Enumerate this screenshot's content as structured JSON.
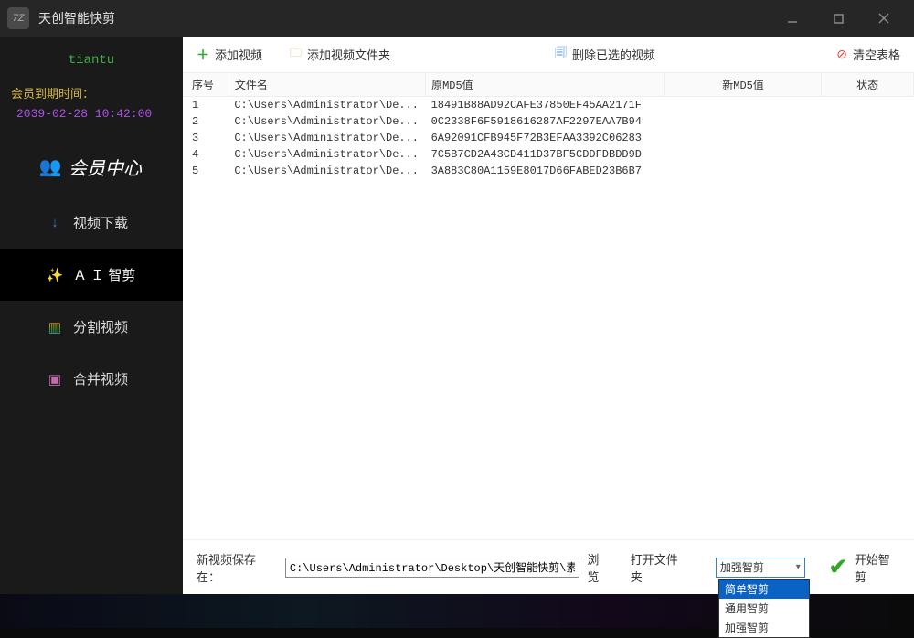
{
  "window": {
    "logo_text": "7Z",
    "title": "天创智能快剪"
  },
  "sidebar": {
    "username": "tiantu",
    "expire_label": "会员到期时间：",
    "expire_time": "2039-02-28 10:42:00",
    "items": [
      {
        "label": "会员中心",
        "icon": "👥"
      },
      {
        "label": "视频下载",
        "icon": "↓"
      },
      {
        "label": "Ａ Ｉ 智剪",
        "icon": "✨"
      },
      {
        "label": "分割视频",
        "icon": "▥"
      },
      {
        "label": "合并视频",
        "icon": "▣"
      }
    ]
  },
  "toolbar": {
    "add_video": "添加视频",
    "add_folder": "添加视频文件夹",
    "delete_selected": "删除已选的视频",
    "clear_table": "清空表格"
  },
  "table": {
    "headers": {
      "index": "序号",
      "filename": "文件名",
      "orig_md5": "原MD5值",
      "new_md5": "新MD5值",
      "status": "状态"
    },
    "rows": [
      {
        "idx": "1",
        "file": "C:\\Users\\Administrator\\De...",
        "md5o": "18491B88AD92CAFE37850EF45AA2171F",
        "md5n": "",
        "status": ""
      },
      {
        "idx": "2",
        "file": "C:\\Users\\Administrator\\De...",
        "md5o": "0C2338F6F5918616287AF2297EAA7B94",
        "md5n": "",
        "status": ""
      },
      {
        "idx": "3",
        "file": "C:\\Users\\Administrator\\De...",
        "md5o": "6A92091CFB945F72B3EFAA3392C06283",
        "md5n": "",
        "status": ""
      },
      {
        "idx": "4",
        "file": "C:\\Users\\Administrator\\De...",
        "md5o": "7C5B7CD2A43CD411D37BF5CDDFDBDD9D",
        "md5n": "",
        "status": ""
      },
      {
        "idx": "5",
        "file": "C:\\Users\\Administrator\\De...",
        "md5o": "3A883C80A1159E8017D66FABED23B6B7",
        "md5n": "",
        "status": ""
      }
    ]
  },
  "bottom": {
    "save_label": "新视频保存在：",
    "path_value": "C:\\Users\\Administrator\\Desktop\\天创智能快剪\\素材",
    "browse": "浏览",
    "open_folder": "打开文件夹",
    "mode_selected": "加强智剪",
    "mode_options": [
      "简单智剪",
      "通用智剪",
      "加强智剪"
    ],
    "start_label": "开始智剪"
  }
}
